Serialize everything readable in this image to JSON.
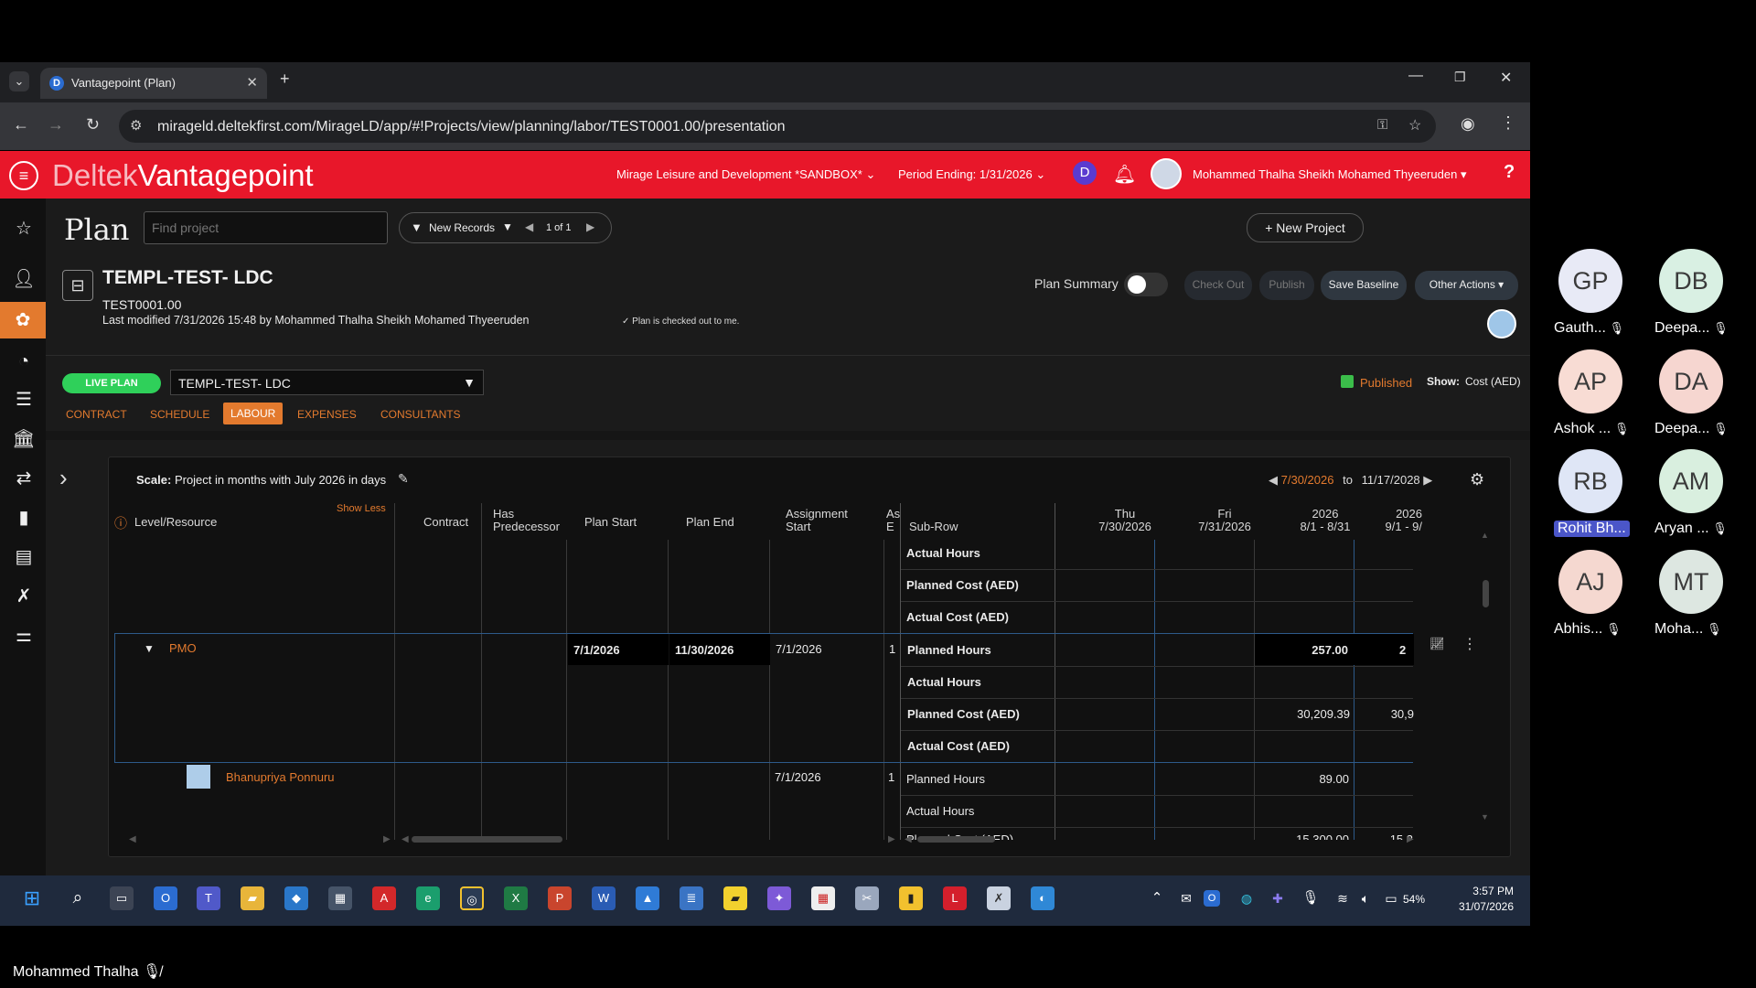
{
  "browser": {
    "tab_title": "Vantagepoint (Plan)",
    "tab_favicon": "D",
    "url": "mirageld.deltekfirst.com/MirageLD/app/#!Projects/view/planning/labor/TEST0001.00/presentation"
  },
  "header": {
    "brand_part1": "Deltek",
    "brand_part2": "Vantagepoint",
    "company": "Mirage Leisure and Development *SANDBOX*",
    "period": "Period Ending: 1/31/2026",
    "user_initial": "D",
    "user_name": "Mohammed Thalha Sheikh Mohamed Thyeeruden",
    "help": "?"
  },
  "toolbar": {
    "page_title": "Plan",
    "search_placeholder": "Find project",
    "filter_label": "New Records",
    "pager": "1 of 1",
    "new_project": "New Project"
  },
  "project": {
    "name": "TEMPL-TEST- LDC",
    "number": "TEST0001.00",
    "last_modified": "Last modified 7/31/2026 15:48 by Mohammed Thalha Sheikh Mohamed Thyeeruden",
    "checkout_note": "Plan is checked out to me.",
    "plan_summary_label": "Plan Summary",
    "check_out": "Check Out",
    "publish": "Publish",
    "save_baseline": "Save Baseline",
    "other_actions": "Other Actions",
    "live_plan": "LIVE PLAN",
    "plan_select": "TEMPL-TEST- LDC",
    "published": "Published",
    "show_label": "Show:",
    "show_value": "Cost (AED)"
  },
  "tabs": [
    "CONTRACT",
    "SCHEDULE",
    "LABOUR",
    "EXPENSES",
    "CONSULTANTS"
  ],
  "active_tab": "LABOUR",
  "grid": {
    "scale_label": "Scale:",
    "scale_value": "Project in months with July 2026 in days",
    "range_start": "7/30/2026",
    "range_to": "to",
    "range_end": "11/17/2028",
    "show_less": "Show Less",
    "columns": {
      "level": "Level/Resource",
      "contract": "Contract",
      "has_pred_1": "Has",
      "has_pred_2": "Predecessor",
      "plan_start": "Plan Start",
      "plan_end": "Plan End",
      "assign_1": "Assignment",
      "assign_2": "Start",
      "ae_1": "As",
      "ae_2": "E",
      "subrow": "Sub-Row"
    },
    "time_columns": [
      {
        "top": "Thu",
        "bottom": "7/30/2026"
      },
      {
        "top": "Fri",
        "bottom": "7/31/2026"
      },
      {
        "top": "2026",
        "bottom": "8/1 - 8/31"
      },
      {
        "top": "2026",
        "bottom": "9/1 - 9/"
      }
    ],
    "rows_top": [
      "Actual Hours",
      "Planned Cost (AED)",
      "Actual Cost (AED)"
    ],
    "pmo": {
      "name": "PMO",
      "plan_start": "7/1/2026",
      "plan_end": "11/30/2026",
      "assign_start": "7/1/2026",
      "ae": "1",
      "subrows": [
        "Planned Hours",
        "Actual Hours",
        "Planned Cost (AED)",
        "Actual Cost (AED)"
      ],
      "aug_planned_hours": "257.00",
      "sep_planned_hours": "2",
      "aug_planned_cost": "30,209.39",
      "sep_planned_cost": "30,9"
    },
    "resource": {
      "name": "Bhanupriya Ponnuru",
      "assign_start": "7/1/2026",
      "ae": "1",
      "subrows": [
        "Planned Hours",
        "Actual Hours",
        "Planned Cost (AED)"
      ],
      "aug_planned_hours": "89.00",
      "aug_planned_cost": "15,300.00",
      "sep_planned_cost": "15,3"
    }
  },
  "participants": [
    {
      "initials": "GP",
      "name": "Gauth...",
      "color": "#e8eaf6"
    },
    {
      "initials": "DB",
      "name": "Deepa...",
      "color": "#d9f0e3"
    },
    {
      "initials": "AP",
      "name": "Ashok ...",
      "color": "#f8dcd4"
    },
    {
      "initials": "DA",
      "name": "Deepa...",
      "color": "#f6d6d0"
    },
    {
      "initials": "RB",
      "name": "Rohit Bh...",
      "color": "#dfe6f6"
    },
    {
      "initials": "AM",
      "name": "Aryan ...",
      "color": "#d9efdf"
    },
    {
      "initials": "AJ",
      "name": "Abhis...",
      "color": "#f5d8d0"
    },
    {
      "initials": "MT",
      "name": "Moha...",
      "color": "#dde7e1"
    }
  ],
  "presenter_name": "Mohammed Thalha",
  "taskbar": {
    "battery": "54%",
    "time": "3:57 PM",
    "date": "31/07/2026"
  },
  "colors": {
    "brand_red": "#e8172a",
    "accent_orange": "#e37a2e",
    "live_green": "#2fd05a",
    "published_green": "#3bbd4a"
  }
}
